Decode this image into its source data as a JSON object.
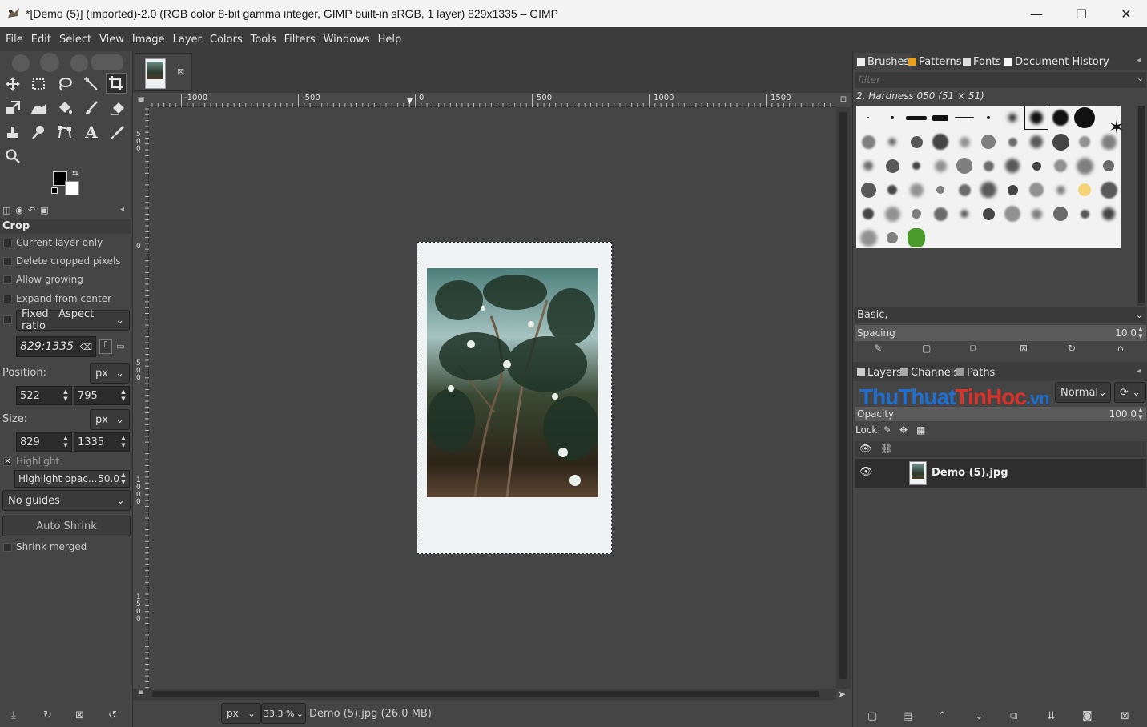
{
  "window": {
    "title": "*[Demo (5)] (imported)-2.0 (RGB color 8-bit gamma integer, GIMP built-in sRGB, 1 layer) 829x1335 – GIMP",
    "minimize": "—",
    "maximize": "☐",
    "close": "✕"
  },
  "menu": [
    "File",
    "Edit",
    "Select",
    "View",
    "Image",
    "Layer",
    "Colors",
    "Tools",
    "Filters",
    "Windows",
    "Help"
  ],
  "tools": [
    "move-icon",
    "rect-select-icon",
    "lasso-icon",
    "fuzzy-select-icon",
    "crop-icon",
    "transform-icon",
    "warp-icon",
    "bucket-fill-icon",
    "paintbrush-icon",
    "eraser-icon",
    "clone-icon",
    "smudge-icon",
    "paths-icon",
    "text-icon",
    "color-picker-icon",
    "zoom-icon"
  ],
  "tool_options": {
    "title": "Crop",
    "current_layer_only": "Current layer only",
    "delete_cropped": "Delete cropped pixels",
    "allow_growing": "Allow growing",
    "expand_center": "Expand from center",
    "fixed": "Fixed",
    "fixed_mode": "Aspect ratio",
    "ratio": "829:1335",
    "position_label": "Position:",
    "position_unit": "px",
    "pos_x": "522",
    "pos_y": "795",
    "size_label": "Size:",
    "size_unit": "px",
    "size_w": "829",
    "size_h": "1335",
    "highlight": "Highlight",
    "highlight_opacity_label": "Highlight opac...",
    "highlight_opacity": "50.0",
    "guides": "No guides",
    "auto_shrink": "Auto Shrink",
    "shrink_merged": "Shrink merged"
  },
  "ruler": {
    "h_labels": [
      "-1000",
      "-500",
      "0",
      "500",
      "1000",
      "1500"
    ],
    "v_labels": [
      "500",
      "0",
      "500",
      "1000",
      "1500"
    ]
  },
  "status": {
    "unit": "px",
    "zoom": "33.3 %",
    "info": "Demo (5).jpg (26.0 MB)"
  },
  "brushes": {
    "tabs": [
      "Brushes",
      "Patterns",
      "Fonts",
      "Document History"
    ],
    "filter_placeholder": "filter",
    "selected": "2. Hardness 050 (51 × 51)",
    "preset": "Basic,",
    "spacing_label": "Spacing",
    "spacing_value": "10.0"
  },
  "layers": {
    "tabs": [
      "Layers",
      "Channels",
      "Paths"
    ],
    "mode": "Normal",
    "opacity_label": "Opacity",
    "opacity_value": "100.0",
    "lock_label": "Lock:",
    "items": [
      {
        "name": "Demo (5).jpg"
      }
    ],
    "watermark": "ThuThuatTinHoc.vn"
  },
  "colors": {
    "bg_dark": "#454545",
    "selection": "#f0e04a",
    "watermark_blue": "#1f6fd1",
    "watermark_red": "#d9322b"
  }
}
